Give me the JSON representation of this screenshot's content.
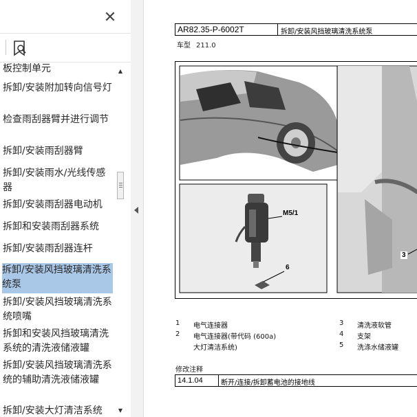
{
  "sidebar": {
    "close_glyph": "✕",
    "bookmark_icon": "bookmark-search-icon",
    "items": [
      {
        "label": "板控制单元",
        "partial": true
      },
      {
        "label": "拆卸/安装附加转向信号灯"
      },
      {
        "label": "检查雨刮器臂并进行调节"
      },
      {
        "label": "拆卸/安装雨刮器臂"
      },
      {
        "label": "拆卸/安装雨水/光线传感器"
      },
      {
        "label": "拆卸/安装雨刮器电动机"
      },
      {
        "label": "拆卸和安装雨刮器系统"
      },
      {
        "label": "拆卸/安装雨刮器连杆"
      },
      {
        "label": "拆卸/安装风挡玻璃清洗系统泵",
        "selected": true
      },
      {
        "label": "拆卸/安装风挡玻璃清洗系统喷嘴"
      },
      {
        "label": "拆卸和安装风挡玻璃清洗系统的清洗液储液罐"
      },
      {
        "label": "拆卸/安装风挡玻璃清洗系统的辅助清洗液储液罐"
      },
      {
        "label": "拆卸/安装大灯清洁系统"
      }
    ],
    "scroll_up": "▲",
    "scroll_down": "▼",
    "selected_color": "#a9c7e6"
  },
  "document": {
    "code": "AR82.35-P-6002T",
    "title": "拆卸/安装风挡玻璃清洗系统泵",
    "model_label": "车型",
    "model_value": "211.0",
    "figure": {
      "callout_pump": "M5/1",
      "callout_6": "6",
      "callout_3": "3"
    },
    "legend": [
      {
        "num": "1",
        "text": "电气连接器"
      },
      {
        "num": "2",
        "text": "电气连接器(带代码 (600a)"
      },
      {
        "num": "",
        "text": "大灯清洁系统)"
      },
      {
        "num": "3",
        "text": "清洗液软管"
      },
      {
        "num": "4",
        "text": "支架"
      },
      {
        "num": "5",
        "text": "洗涤水储液罐"
      }
    ],
    "revision": {
      "title": "修改注释",
      "date": "14.1.04",
      "text": "断开/连接/拆卸蓄电池的接地线"
    }
  }
}
